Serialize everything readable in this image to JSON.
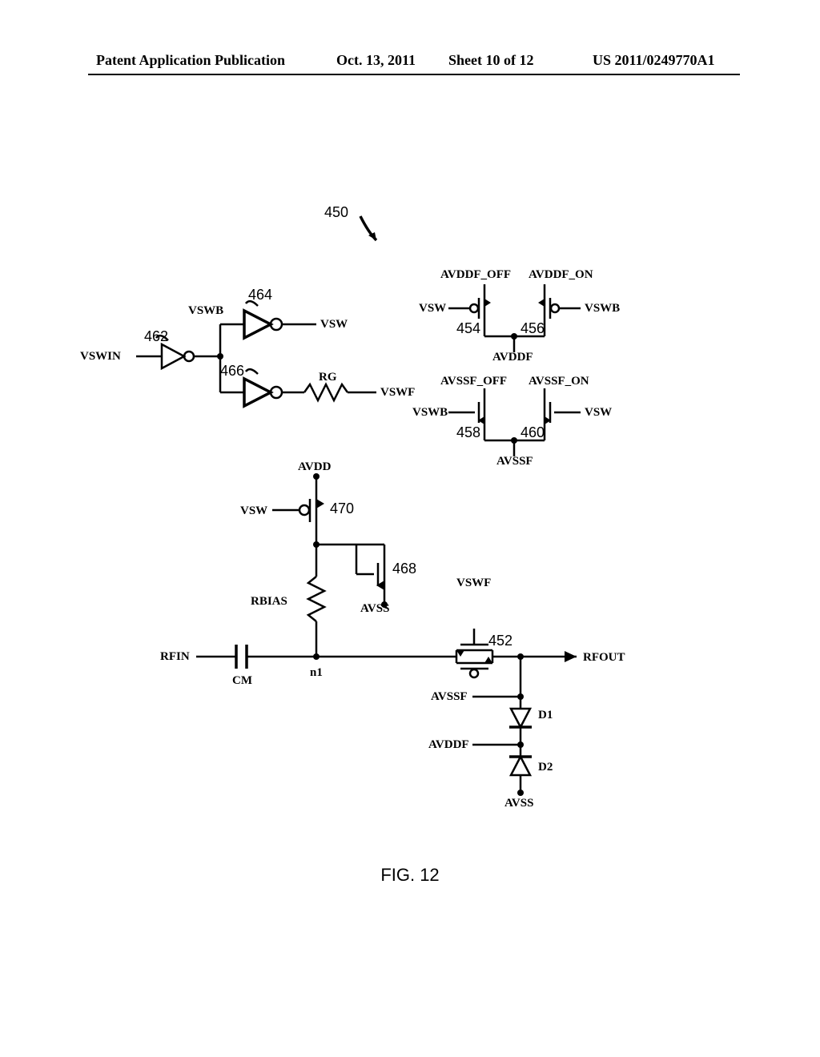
{
  "header": {
    "left": "Patent Application Publication",
    "date": "Oct. 13, 2011",
    "sheet": "Sheet 10 of 12",
    "pubno": "US 2011/0249770A1"
  },
  "fig": {
    "caption": "FIG. 12",
    "top_ref": "450"
  },
  "refs": {
    "r452": "452",
    "r454": "454",
    "r456": "456",
    "r458": "458",
    "r460": "460",
    "r462": "462",
    "r464": "464",
    "r466": "466",
    "r468": "468",
    "r470": "470"
  },
  "labels": {
    "vswin": "VSWIN",
    "vswb": "VSWB",
    "vsw": "VSW",
    "vswf": "VSWF",
    "rg": "RG",
    "avddf_off": "AVDDF_OFF",
    "avddf_on": "AVDDF_ON",
    "avddf": "AVDDF",
    "avssf_off": "AVSSF_OFF",
    "avssf_on": "AVSSF_ON",
    "avssf": "AVSSF",
    "avdd": "AVDD",
    "avss": "AVSS",
    "rbias": "RBIAS",
    "rfin": "RFIN",
    "rfout": "RFOUT",
    "cm": "CM",
    "n1": "n1",
    "d1": "D1",
    "d2": "D2"
  }
}
